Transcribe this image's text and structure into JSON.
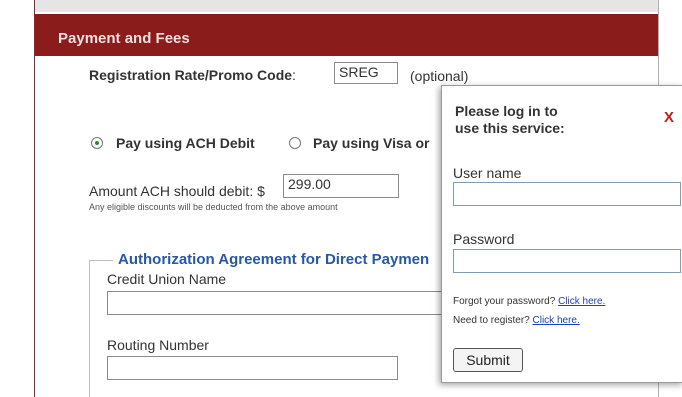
{
  "section": {
    "title": "Payment and Fees"
  },
  "registration": {
    "label": "Registration Rate/Promo Code",
    "colon": ":",
    "code_value": "SREG",
    "optional_note": "(optional)"
  },
  "payment_options": {
    "ach_label": "Pay using ACH Debit",
    "ach_selected": true,
    "card_label": "Pay using Visa or"
  },
  "ach_amount": {
    "label": "Amount ACH should debit: $",
    "value": "299.00",
    "note": "Any eligible discounts will be deducted from the above amount"
  },
  "authorization": {
    "legend": "Authorization Agreement for Direct Paymen",
    "credit_union_label": "Credit Union Name",
    "routing_label": "Routing Number"
  },
  "login_popup": {
    "title_line1": "Please log in to",
    "title_line2": "use this service:",
    "close_label": "X",
    "username_label": "User name",
    "password_label": "Password",
    "forgot_text": "Forgot your password? ",
    "forgot_link": "Click here.",
    "register_text": "Need to register? ",
    "register_link": "Click here.",
    "submit_label": "Submit"
  },
  "colors": {
    "section_bar": "#8b1c1c",
    "legend": "#2757a8",
    "close": "#c21a1a",
    "link": "#1a3fbf"
  }
}
